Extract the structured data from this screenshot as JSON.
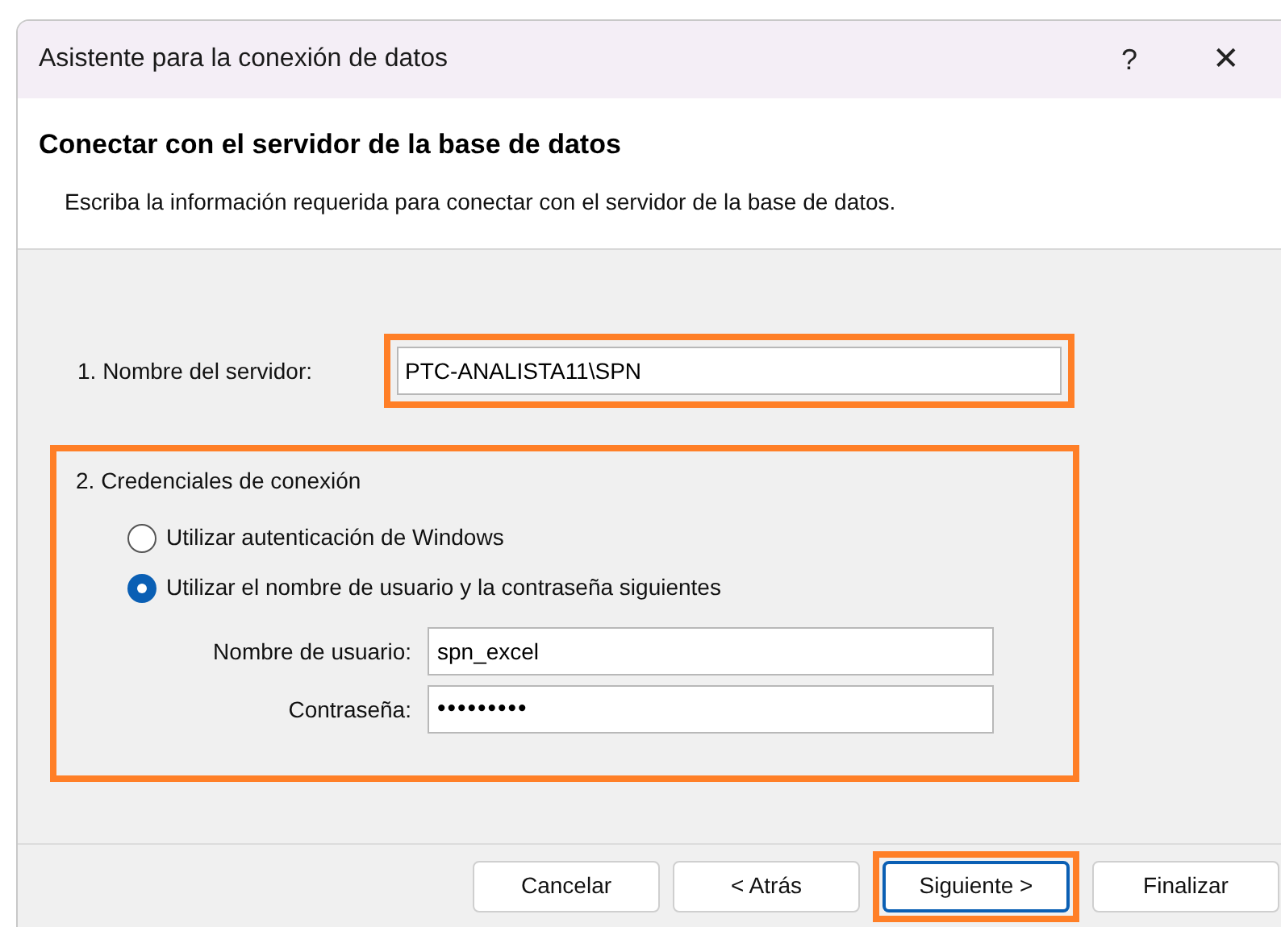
{
  "window": {
    "title": "Asistente para la conexión de datos",
    "help": "?",
    "close": "✕"
  },
  "header": {
    "title": "Conectar con el servidor de la base de datos",
    "subtitle": "Escriba la información requerida para conectar con el servidor de la base de datos."
  },
  "server": {
    "label": "1. Nombre del servidor:",
    "value": "PTC-ANALISTA11\\SPN",
    "highlighted": true
  },
  "credentials": {
    "title": "2. Credenciales de conexión",
    "highlighted": true,
    "options": [
      {
        "label": "Utilizar autenticación de Windows",
        "selected": false
      },
      {
        "label": "Utilizar el nombre de usuario y la contraseña siguientes",
        "selected": true
      }
    ],
    "fields": [
      {
        "label": "Nombre de usuario:",
        "value": "spn_excel",
        "kind": "text"
      },
      {
        "label": "Contraseña:",
        "value": "•••••••••",
        "kind": "password"
      }
    ]
  },
  "buttons": [
    {
      "label": "Cancelar",
      "highlighted": false,
      "focused": false
    },
    {
      "label": "< Atrás",
      "highlighted": false,
      "focused": false
    },
    {
      "label": "Siguiente >",
      "highlighted": true,
      "focused": true
    },
    {
      "label": "Finalizar",
      "highlighted": false,
      "focused": false
    }
  ]
}
